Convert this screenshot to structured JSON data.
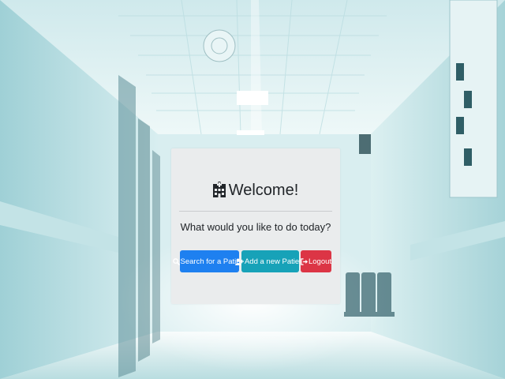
{
  "welcome": {
    "title": "Welcome!",
    "subtitle": "What would you like to do today?",
    "icon": "hospital-icon"
  },
  "actions": {
    "search_label": "Search for a Patient",
    "search_icon": "search-icon",
    "add_label": "Add a new Patient",
    "add_icon": "user-plus-icon",
    "logout_label": "Logout",
    "logout_icon": "sign-out-icon"
  },
  "colors": {
    "search_button": "#1e80f0",
    "add_button": "#17a2b8",
    "logout_button": "#dc3545",
    "card_background": "#eaeced"
  }
}
